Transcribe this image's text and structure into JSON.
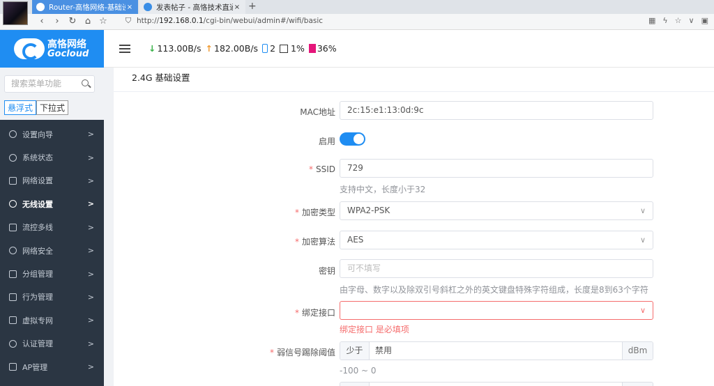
{
  "browser": {
    "tabs": [
      {
        "title": "Router-高恪网络-基础设",
        "close": "×"
      },
      {
        "title": "发表帖子 - 高恪技术直通",
        "close": "×"
      }
    ],
    "new_tab": "+",
    "url_prefix": "http://",
    "url_host": "192.168.0.1",
    "url_path": "/cgi-bin/webui/admin#/wifi/basic"
  },
  "logo": {
    "cn": "高恪网络",
    "en": "Gocloud"
  },
  "sidebar": {
    "search_placeholder": "搜索菜单功能",
    "modes": [
      "悬浮式",
      "下拉式"
    ],
    "items": [
      {
        "label": "设置向导",
        "icon": "compass-icon"
      },
      {
        "label": "系统状态",
        "icon": "dashboard-icon"
      },
      {
        "label": "网络设置",
        "icon": "monitor-icon"
      },
      {
        "label": "无线设置",
        "icon": "wifi-icon"
      },
      {
        "label": "流控多线",
        "icon": "network-icon"
      },
      {
        "label": "网络安全",
        "icon": "shield-icon"
      },
      {
        "label": "分组管理",
        "icon": "list-icon"
      },
      {
        "label": "行为管理",
        "icon": "filter-icon"
      },
      {
        "label": "虚拟专网",
        "icon": "vpn-icon"
      },
      {
        "label": "认证管理",
        "icon": "auth-shield-icon"
      },
      {
        "label": "AP管理",
        "icon": "sitemap-icon"
      }
    ],
    "chevron": ">"
  },
  "header": {
    "down_arrow": "↓",
    "down_rate": "113.00B/s",
    "up_arrow": "↑",
    "up_rate": "182.00B/s",
    "devices": "2",
    "cpu": "1%",
    "memory": "36%"
  },
  "form": {
    "title": "2.4G 基础设置",
    "mac_label": "MAC地址",
    "mac_value": "2c:15:e1:13:0d:9c",
    "enable_label": "启用",
    "enable_on": true,
    "ssid_label": "SSID",
    "ssid_value": "729",
    "ssid_hint": "支持中文，长度小于32",
    "enc_type_label": "加密类型",
    "enc_type_value": "WPA2-PSK",
    "enc_alg_label": "加密算法",
    "enc_alg_value": "AES",
    "key_label": "密钥",
    "key_placeholder": "可不填写",
    "key_hint": "由字母、数字以及除双引号斜杠之外的英文键盘特殊字符组成，长度是8到63个字符",
    "bind_label": "绑定接口",
    "bind_error": "绑定接口 是必填项",
    "weak_label": "弱信号踢除阈值",
    "weak_prefix": "少于",
    "weak_value": "禁用",
    "weak_unit": "dBm",
    "weak_hint": "-100 ~ 0",
    "required_mark": "*",
    "chevron": "∨"
  }
}
